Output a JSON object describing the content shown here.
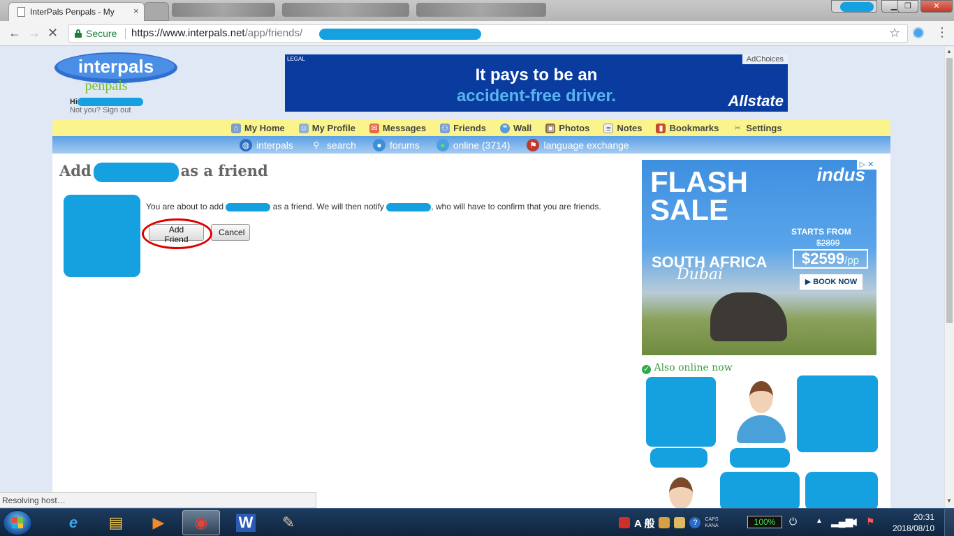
{
  "browser": {
    "active_tab_title": "InterPals Penpals - My",
    "tab_close": "×",
    "secure_label": "Secure",
    "url_base": "https://www.interpals.net",
    "url_path": "/app/friends/",
    "status_text": "Resolving host…"
  },
  "site": {
    "logo_top": "interpals",
    "logo_bottom": "penpals",
    "greeting": "Hi",
    "not_you": "Not you?",
    "sign_out": "Sign out",
    "nav_primary": [
      {
        "label": "My Home",
        "icon": "home-icon"
      },
      {
        "label": "My Profile",
        "icon": "profile-icon"
      },
      {
        "label": "Messages",
        "icon": "envelope-icon"
      },
      {
        "label": "Friends",
        "icon": "friends-icon"
      },
      {
        "label": "Wall",
        "icon": "wall-icon"
      },
      {
        "label": "Photos",
        "icon": "photos-icon"
      },
      {
        "label": "Notes",
        "icon": "notes-icon"
      },
      {
        "label": "Bookmarks",
        "icon": "bookmark-icon"
      },
      {
        "label": "Settings",
        "icon": "settings-icon"
      }
    ],
    "nav_secondary": [
      {
        "label": "interpals",
        "icon": "globe-icon"
      },
      {
        "label": "search",
        "icon": "magnifier-icon"
      },
      {
        "label": "forums",
        "icon": "forum-bubble-icon"
      },
      {
        "label": "online (3714)",
        "icon": "online-user-icon"
      },
      {
        "label": "language exchange",
        "icon": "flags-icon"
      }
    ]
  },
  "main": {
    "title_prefix": "Add",
    "title_suffix": "as a friend",
    "confirm_part1": "You are about to add",
    "confirm_part2": "as a friend. We will then notify",
    "confirm_part3": ", who will have to confirm that you are friends.",
    "add_friend_label": "Add Friend",
    "cancel_label": "Cancel"
  },
  "ads": {
    "top": {
      "legal": "LEGAL",
      "adchoices": "AdChoices",
      "line1": "It pays to be an",
      "line2": "accident-free driver.",
      "brand": "Allstate"
    },
    "side": {
      "close": "▷ ✕",
      "brand": "indus",
      "headline_1": "FLASH",
      "headline_2": "SALE",
      "destination_1": "SOUTH AFRICA",
      "destination_2": "Dubai",
      "starts_from": "STARTS FROM",
      "old_price": "$2899",
      "price": "$2599",
      "price_unit": "/pp",
      "cta": "▶ BOOK NOW"
    }
  },
  "sidebar": {
    "also_online": "Also online now"
  },
  "taskbar": {
    "ime_mode": "A 般",
    "caps": "CAPS",
    "kana": "KANA",
    "battery": "100%",
    "time": "20:31",
    "date": "2018/08/10",
    "apps": [
      {
        "name": "ie-icon",
        "glyph": "e"
      },
      {
        "name": "explorer-icon",
        "glyph": "▤"
      },
      {
        "name": "media-player-icon",
        "glyph": "▶"
      },
      {
        "name": "chrome-icon",
        "glyph": "◉"
      },
      {
        "name": "word-icon",
        "glyph": "W"
      },
      {
        "name": "paint-icon",
        "glyph": "✎"
      }
    ]
  },
  "colors": {
    "accent_yellow": "#fbf48d",
    "accent_blue": "#5c9fe4",
    "redaction": "#15a0e0",
    "highlight_ring": "#dd0000",
    "online_green": "#3a9a3a"
  }
}
